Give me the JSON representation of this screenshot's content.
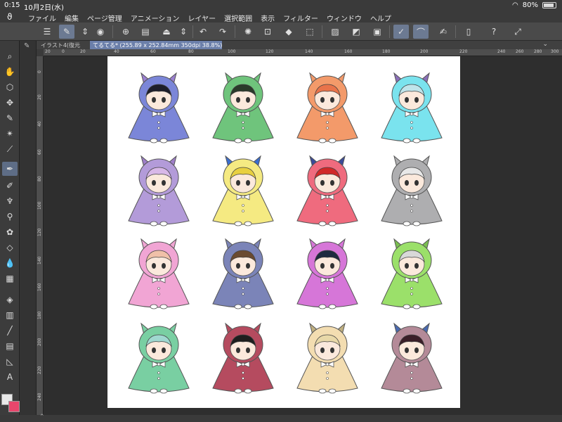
{
  "status": {
    "time": "0:15",
    "date": "10月2日(水)",
    "battery": "80%"
  },
  "menu": {
    "items": [
      "ファイル",
      "編集",
      "ページ管理",
      "アニメーション",
      "レイヤー",
      "選択範囲",
      "表示",
      "フィルター",
      "ウィンドウ",
      "ヘルプ"
    ]
  },
  "tabs": [
    {
      "label": "イラスト4(復元"
    },
    {
      "label": "てるてる* (255.89 x 252.84mm 350dpi 38.8%)"
    }
  ],
  "ruler": {
    "h_ticks": [
      "20",
      "0",
      "20",
      "40",
      "60",
      "80",
      "100",
      "120",
      "140",
      "160",
      "180",
      "200",
      "220",
      "240",
      "260",
      "280",
      "300"
    ],
    "v_ticks": [
      "0",
      "20",
      "40",
      "60",
      "80",
      "100",
      "120",
      "140",
      "160",
      "180",
      "200",
      "220",
      "240"
    ]
  },
  "colors": {
    "main": "#e8e8e8",
    "sub": "#e8466c",
    "accent": "#6b7faa"
  },
  "icons": {
    "toolbar": [
      "hamburger-icon",
      "layer-select-icon",
      "stepper-icon",
      "camera-icon",
      "new-file-icon",
      "open-folder-icon",
      "save-icon",
      "undo-icon",
      "redo-icon",
      "spinner-icon",
      "fill-icon",
      "transform-icon",
      "mask-icon",
      "ref-icon",
      "brush-icon",
      "pen-icon",
      "device-icon",
      "help-icon",
      "expand-icon"
    ],
    "left_tools": [
      "zoom-icon",
      "hand-icon",
      "object-icon",
      "move-icon",
      "lasso-icon",
      "auto-select-icon",
      "eyedropper-icon",
      "pen-tool-icon",
      "pencil-icon",
      "brush-icon",
      "airbrush-icon",
      "decoration-icon",
      "eraser-icon",
      "blend-icon",
      "fill-tool-icon",
      "gradient-icon",
      "figure-icon",
      "frame-icon",
      "ruler-icon",
      "text-icon"
    ]
  },
  "figures": [
    {
      "name": "purple-blue-demon",
      "cloak": "#7b86d8",
      "hair": "#1e1e2a",
      "horn": "#9a7fd0"
    },
    {
      "name": "green-frog",
      "cloak": "#6fc47c",
      "hair": "#2a3a2a",
      "horn": "#6fc47c"
    },
    {
      "name": "orange-star",
      "cloak": "#f39a6a",
      "hair": "#e8734a",
      "horn": "#f39a6a"
    },
    {
      "name": "cyan-monster",
      "cloak": "#7ae3ee",
      "hair": "#bfe4ea",
      "horn": "#8a6fb8"
    },
    {
      "name": "lavender-ram",
      "cloak": "#b39bd9",
      "hair": "#d8b8e8",
      "horn": "#9e7ec8"
    },
    {
      "name": "yellow-dino",
      "cloak": "#f5ea82",
      "hair": "#e8d040",
      "horn": "#3a6ed0"
    },
    {
      "name": "red-dragon",
      "cloak": "#ef6b7e",
      "hair": "#d02828",
      "horn": "#3a4a9a"
    },
    {
      "name": "gray-cat",
      "cloak": "#aeaeb0",
      "hair": "#e8e8e8",
      "horn": "#aeaeb0"
    },
    {
      "name": "pink-mouse",
      "cloak": "#f1a5d4",
      "hair": "#f0c0a8",
      "horn": "#f1a5d4"
    },
    {
      "name": "slate-cat",
      "cloak": "#7b84b8",
      "hair": "#6a4a30",
      "horn": "#7b84b8"
    },
    {
      "name": "magenta-rose",
      "cloak": "#d676d8",
      "hair": "#1e2a40",
      "horn": "#d676d8"
    },
    {
      "name": "lime-lizard",
      "cloak": "#9be06a",
      "hair": "#d8d8d8",
      "horn": "#7ac050"
    },
    {
      "name": "teal-dragon",
      "cloak": "#79cfa2",
      "hair": "#9fd8d0",
      "horn": "#79cfa2"
    },
    {
      "name": "maroon-devil",
      "cloak": "#b54b5f",
      "hair": "#1e1e1e",
      "horn": "#b54b5f"
    },
    {
      "name": "cream-bug",
      "cloak": "#f3ddb1",
      "hair": "#e8d8a8",
      "horn": "#c0b080"
    },
    {
      "name": "mauve-bug",
      "cloak": "#b48a98",
      "hair": "#3a1e28",
      "horn": "#4a6ab0"
    }
  ]
}
